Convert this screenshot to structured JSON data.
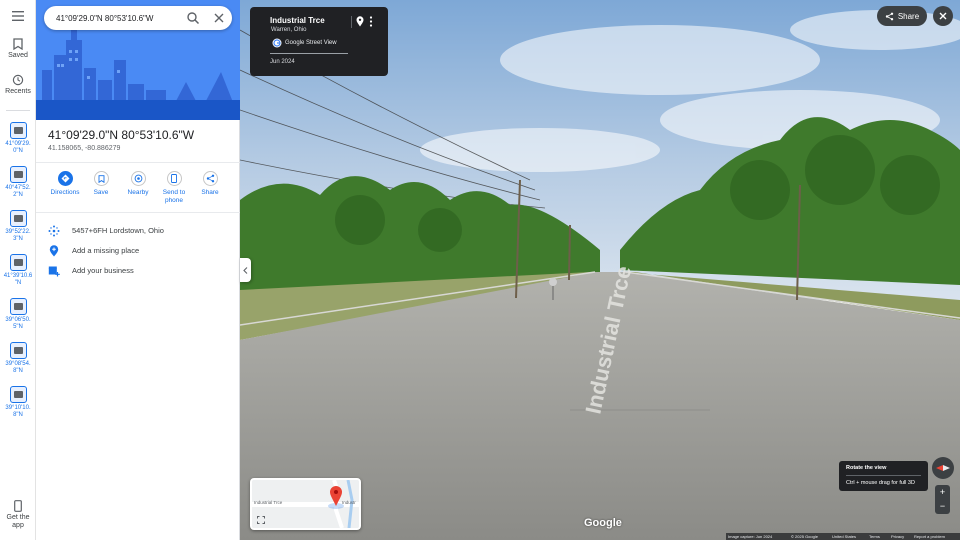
{
  "search": {
    "value": "41°09'29.0\"N 80°53'10.6\"W"
  },
  "rail": {
    "saved_label": "Saved",
    "recents_label": "Recents",
    "get_app_label": "Get the app",
    "recent_items": [
      {
        "label": "41°09'29. 0\"N"
      },
      {
        "label": "40°47'52. 2\"N"
      },
      {
        "label": "39°52'22. 3\"N"
      },
      {
        "label": "41°39'10.6 \"N"
      },
      {
        "label": "39°06'50. 5\"N"
      },
      {
        "label": "39°08'54. 8\"N"
      },
      {
        "label": "39°10'10. 8\"N"
      }
    ]
  },
  "place": {
    "title": "41°09'29.0\"N 80°53'10.6\"W",
    "coords": "41.158065, -80.886279"
  },
  "actions": {
    "directions": "Directions",
    "save": "Save",
    "nearby": "Nearby",
    "send_to_phone": "Send to phone",
    "share": "Share"
  },
  "info": {
    "plus_code": "5457+6FH Lordstown, Ohio",
    "add_missing_place": "Add a missing place",
    "add_business": "Add your business"
  },
  "streetview": {
    "title": "Industrial Trce",
    "subtitle": "Warren, Ohio",
    "source": "Google Street View",
    "date": "Jun 2024",
    "road_text": "Industrial Trce",
    "minimap_label_left": "Industrial Trce",
    "minimap_label_right": "Industr"
  },
  "top_right": {
    "share_label": "Share"
  },
  "rotate_tip": {
    "title": "Rotate the view",
    "hint": "Ctrl + mouse drag for full 3D"
  },
  "zoom": {
    "in": "+",
    "out": "−"
  },
  "footer": {
    "google": "Google",
    "capture": "Image capture: Jun 2024",
    "copyright": "© 2025 Google",
    "country": "United States",
    "terms": "Terms",
    "privacy": "Privacy",
    "report": "Report a problem"
  },
  "colors": {
    "accent": "#1a73e8",
    "hero": "#4285f4",
    "dark_overlay": "#202124",
    "sky": "#8fb6e0",
    "foliage": "#3f7a2c",
    "asphalt": "#9a9a96"
  }
}
